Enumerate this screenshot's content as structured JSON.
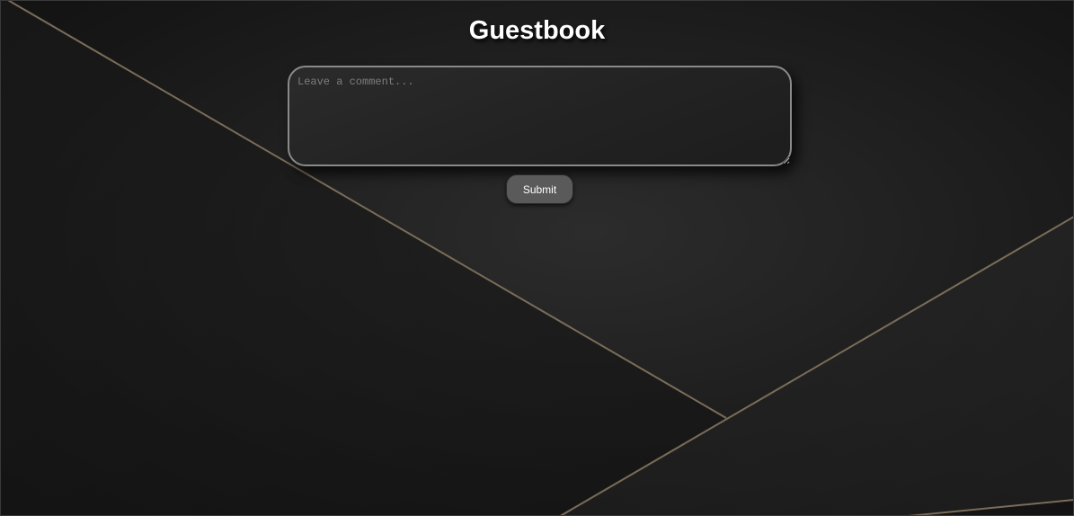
{
  "page": {
    "title": "Guestbook"
  },
  "form": {
    "comment_placeholder": "Leave a comment...",
    "comment_value": "",
    "submit_label": "Submit"
  },
  "theme": {
    "background": "#1b1b1b",
    "accent_line": "#7a6c58",
    "button_bg": "#5a5a5a",
    "text": "#ffffff"
  }
}
